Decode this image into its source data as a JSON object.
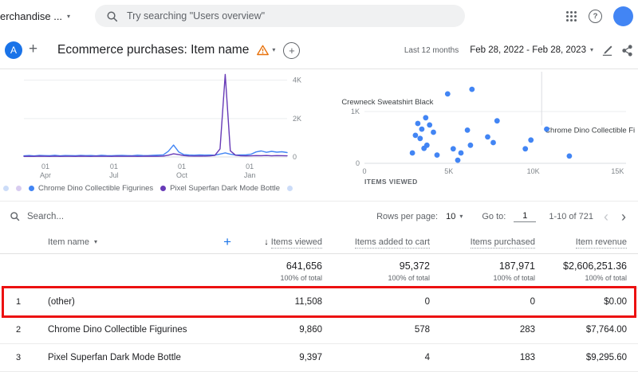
{
  "topbar": {
    "account_label": "erchandise ...",
    "search_placeholder": "Try searching \"Users overview\""
  },
  "report_header": {
    "comparison_letter": "A",
    "title": "Ecommerce purchases: Item name",
    "date_preset": "Last 12 months",
    "date_range": "Feb 28, 2022 - Feb 28, 2023"
  },
  "legend": {
    "faded_colors": [
      "#ccdcf8",
      "#d8ccf0",
      "#ccdcf8"
    ],
    "items": [
      {
        "label": "Chrome Dino Collectible Figurines",
        "color": "#4285f4"
      },
      {
        "label": "Pixel Superfan Dark Mode Bottle",
        "color": "#673ab7"
      }
    ]
  },
  "controls": {
    "search_placeholder": "Search...",
    "rows_per_page_label": "Rows per page:",
    "rows_per_page_value": "10",
    "goto_label": "Go to:",
    "goto_value": "1",
    "range_label": "1-10 of 721",
    "prev_glyph": "‹",
    "next_glyph": "›"
  },
  "table": {
    "columns": {
      "name": "Item name",
      "items_viewed": "Items viewed",
      "items_added": "Items added to cart",
      "items_purchased": "Items purchased",
      "item_revenue": "Item revenue"
    },
    "totals": {
      "items_viewed": "641,656",
      "items_added": "95,372",
      "items_purchased": "187,971",
      "item_revenue": "$2,606,251.36",
      "pct_label": "100% of total"
    },
    "rows": [
      {
        "index": "1",
        "name": "(other)",
        "items_viewed": "11,508",
        "items_added": "0",
        "items_purchased": "0",
        "item_revenue": "$0.00",
        "highlighted": true
      },
      {
        "index": "2",
        "name": "Chrome Dino Collectible Figurines",
        "items_viewed": "9,860",
        "items_added": "578",
        "items_purchased": "283",
        "item_revenue": "$7,764.00",
        "highlighted": false
      },
      {
        "index": "3",
        "name": "Pixel Superfan Dark Mode Bottle",
        "items_viewed": "9,397",
        "items_added": "4",
        "items_purchased": "183",
        "item_revenue": "$9,295.60",
        "highlighted": false
      }
    ]
  },
  "chart_data": [
    {
      "type": "line",
      "ylim": [
        0,
        4360
      ],
      "y_ticks": [
        {
          "label": "4K",
          "value": 4000
        },
        {
          "label": "2K",
          "value": 2000
        },
        {
          "label": "0",
          "value": 0
        }
      ],
      "x_ticks": [
        {
          "line1": "01",
          "line2": "Apr",
          "frac": 0.082
        },
        {
          "line1": "01",
          "line2": "Jul",
          "frac": 0.342
        },
        {
          "line1": "01",
          "line2": "Oct",
          "frac": 0.6
        },
        {
          "line1": "01",
          "line2": "Jan",
          "frac": 0.858
        }
      ],
      "series": [
        {
          "name": "Chrome Dino Collectible Figurines",
          "color": "#4285f4",
          "values": [
            60,
            75,
            55,
            80,
            70,
            65,
            85,
            60,
            75,
            70,
            65,
            80,
            70,
            75,
            60,
            85,
            70,
            65,
            75,
            80,
            70,
            65,
            90,
            75,
            70,
            85,
            95,
            110,
            300,
            620,
            260,
            120,
            100,
            90,
            110,
            95,
            100,
            90,
            150,
            210,
            140,
            95,
            110,
            105,
            140,
            260,
            310,
            240,
            290,
            250,
            270,
            230
          ]
        },
        {
          "name": "Pixel Superfan Dark Mode Bottle",
          "color": "#673ab7",
          "values": [
            30,
            35,
            28,
            40,
            32,
            30,
            38,
            30,
            35,
            35,
            30,
            40,
            35,
            30,
            38,
            32,
            35,
            30,
            40,
            35,
            32,
            38,
            30,
            35,
            40,
            32,
            35,
            45,
            90,
            160,
            120,
            70,
            50,
            45,
            50,
            45,
            55,
            80,
            420,
            4300,
            320,
            90,
            60,
            55,
            60,
            70,
            65,
            75,
            60,
            70,
            65,
            60
          ]
        }
      ]
    },
    {
      "type": "scatter",
      "xlabel": "ITEMS VIEWED",
      "xlim": [
        0,
        15500
      ],
      "ylim": [
        0,
        1770
      ],
      "x_ticks": [
        {
          "label": "0",
          "value": 0
        },
        {
          "label": "5K",
          "value": 5000
        },
        {
          "label": "10K",
          "value": 10000
        },
        {
          "label": "15K",
          "value": 15000
        }
      ],
      "y_ticks": [
        {
          "label": "1K",
          "value": 1000
        },
        {
          "label": "0",
          "value": 0
        }
      ],
      "point_color": "#4285f4",
      "points": [
        [
          2840,
          200
        ],
        [
          3020,
          540
        ],
        [
          3160,
          770
        ],
        [
          3300,
          480
        ],
        [
          3400,
          660
        ],
        [
          3530,
          290
        ],
        [
          3630,
          880
        ],
        [
          3700,
          350
        ],
        [
          3860,
          740
        ],
        [
          4090,
          600
        ],
        [
          4300,
          160
        ],
        [
          4930,
          1340
        ],
        [
          5260,
          280
        ],
        [
          5530,
          60
        ],
        [
          5720,
          200
        ],
        [
          6100,
          640
        ],
        [
          6280,
          350
        ],
        [
          6370,
          1430
        ],
        [
          7300,
          510
        ],
        [
          7630,
          400
        ],
        [
          7860,
          820
        ],
        [
          9530,
          280
        ],
        [
          9860,
          450
        ],
        [
          10800,
          660
        ],
        [
          12140,
          140
        ]
      ],
      "annotations": [
        {
          "text": "Crewneck Sweatshirt Black",
          "x": 4930,
          "y": 1340,
          "dx": -133,
          "dy": 13,
          "leader": false
        },
        {
          "text": "Chrome Dino Collectible Fi",
          "x": 10500,
          "y": 640,
          "dx": 4,
          "dy": 3,
          "leader": true
        }
      ]
    }
  ]
}
